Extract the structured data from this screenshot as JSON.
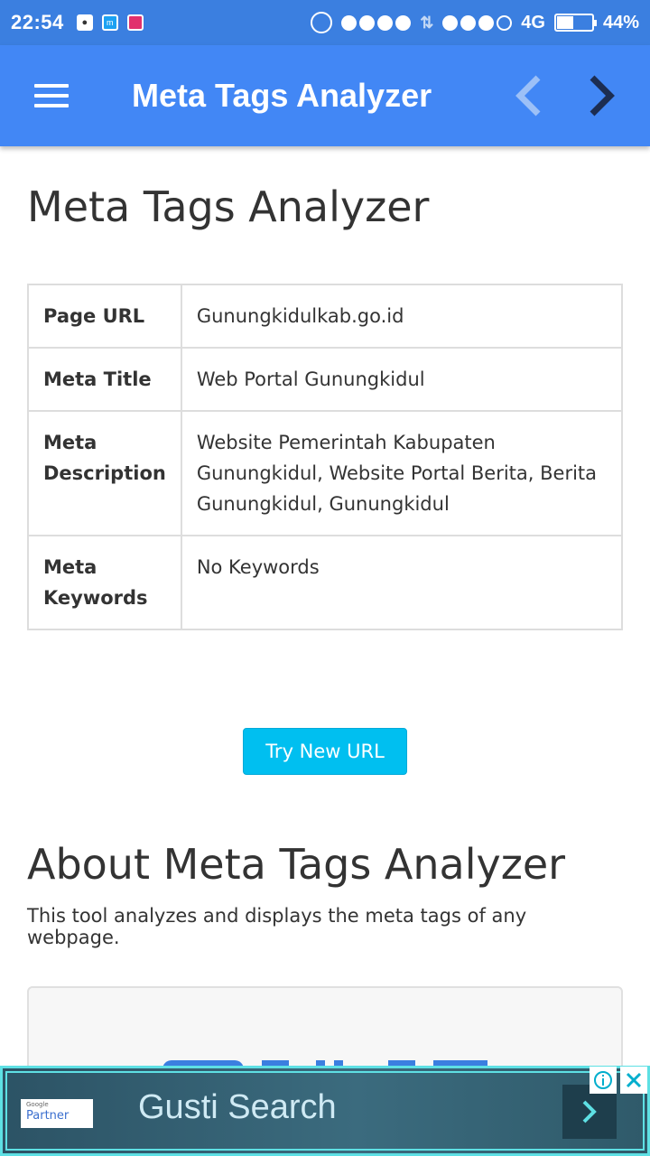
{
  "status_bar": {
    "time": "22:54",
    "network": "4G",
    "battery": "44%",
    "battery_level": 0.44,
    "notification_icons": [
      "bbm-icon",
      "mi-icon",
      "instagram-icon"
    ]
  },
  "app_bar": {
    "title": "Meta Tags Analyzer",
    "menu_icon": "hamburger-menu-icon",
    "back_icon": "chevron-left-icon",
    "forward_icon": "chevron-right-icon"
  },
  "main": {
    "page_title": "Meta Tags Analyzer",
    "results": [
      {
        "label": "Page URL",
        "value": "Gunungkidulkab.go.id"
      },
      {
        "label": "Meta Title",
        "value": "Web Portal Gunungkidul"
      },
      {
        "label": "Meta Description",
        "value": "Website Pemerintah Kabupaten Gunungkidul, Website Portal Berita, Berita Gunungkidul, Gunungkidul"
      },
      {
        "label": "Meta Keywords",
        "value": "No Keywords"
      }
    ],
    "try_button": "Try New URL",
    "about_title": "About Meta Tags Analyzer",
    "about_text": "This tool analyzes and displays the meta tags of any webpage."
  },
  "ad": {
    "partner_small": "Google",
    "partner_label": "Partner",
    "title": "Gusti Search"
  },
  "colors": {
    "status_bar": "#3b7fe0",
    "app_bar": "#4287f5",
    "button": "#00bff0",
    "ad_border": "#5ee0e4"
  }
}
